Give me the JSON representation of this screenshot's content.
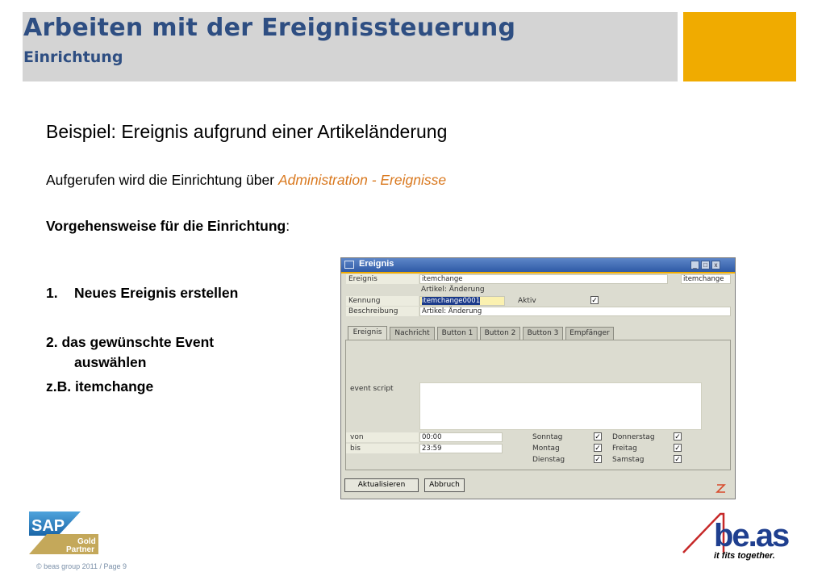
{
  "header": {
    "title": "Arbeiten mit der Ereignissteuerung",
    "subtitle": "Einrichtung"
  },
  "slide": {
    "heading": "Beispiel:  Ereignis aufgrund einer Artikeländerung",
    "intro_prefix": "Aufgerufen wird die Einrichtung über ",
    "intro_link": "Administration - Ereignisse",
    "method_label": "Vorgehensweise für die Einrichtung",
    "method_colon": ":",
    "step1_num": "1.",
    "step1_text": "Neues Ereignis erstellen",
    "step2_line1": "2. das gewünschte Event",
    "step2_line2": "auswählen",
    "step3": "z.B. itemchange"
  },
  "window": {
    "title": "Ereignis",
    "controls": {
      "minimize": "_",
      "maximize": "□",
      "close": "x"
    },
    "fields": {
      "ereignis_label": "Ereignis",
      "ereignis_value": "itemchange",
      "ereignis_right": "itemchange",
      "ereignis_desc": "Artikel: Änderung",
      "kennung_label": "Kennung",
      "kennung_value": "itemchange0001",
      "aktiv_label": "Aktiv",
      "aktiv_checked": "✓",
      "beschreibung_label": "Beschreibung",
      "beschreibung_value": "Artikel: Änderung"
    },
    "tabs": [
      "Ereignis",
      "Nachricht",
      "Button 1",
      "Button 2",
      "Button 3",
      "Empfänger"
    ],
    "panel": {
      "script_label": "event script",
      "von_label": "von",
      "von_value": "00:00",
      "bis_label": "bis",
      "bis_value": "23:59",
      "days": [
        {
          "label": "Sonntag",
          "checked": "✓"
        },
        {
          "label": "Montag",
          "checked": "✓"
        },
        {
          "label": "Dienstag",
          "checked": "✓"
        },
        {
          "label": "Donnerstag",
          "checked": "✓"
        },
        {
          "label": "Freitag",
          "checked": "✓"
        },
        {
          "label": "Samstag",
          "checked": "✓"
        }
      ]
    },
    "buttons": {
      "update": "Aktualisieren",
      "cancel": "Abbruch"
    }
  },
  "footer": {
    "sap_main": "SAP",
    "sap_tier": "Gold",
    "sap_partner": "Partner",
    "beas_word": "be.as",
    "beas_tagline": "it fits together.",
    "copyright": "© beas group 2011 / Page 9"
  },
  "colors": {
    "title_blue": "#2e4e82",
    "accent_orange": "#f0ab00",
    "link_orange": "#d9781e",
    "beas_blue": "#1f3f8f",
    "beas_red": "#c62828"
  }
}
